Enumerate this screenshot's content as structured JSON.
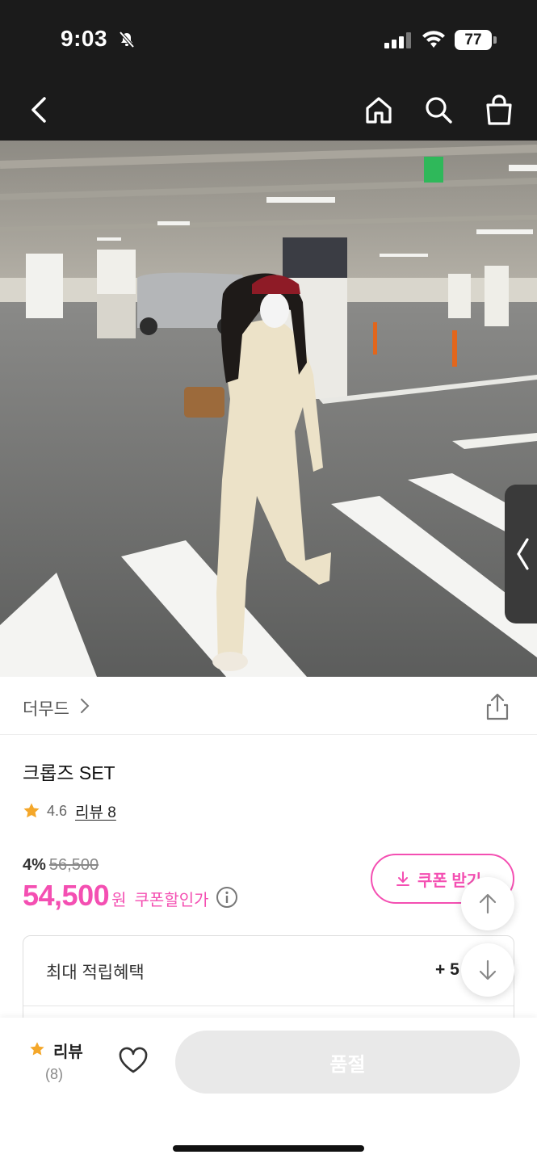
{
  "status_bar": {
    "time": "9:03",
    "battery": "77"
  },
  "nav": {
    "icons": [
      "back-icon",
      "home-icon",
      "search-icon",
      "shopping-bag-icon"
    ]
  },
  "brand": {
    "name": "더무드"
  },
  "product": {
    "title": "크롭즈 SET",
    "rating": "4.6",
    "review_label": "리뷰 8",
    "discount": "4%",
    "original_price": "56,500",
    "price": "54,500",
    "currency": "원",
    "coupon_price_label": "쿠폰할인가",
    "coupon_button": "쿠폰 받기"
  },
  "points": {
    "label": "최대 적립혜택",
    "value": "+ 5"
  },
  "bottom_bar": {
    "review_label": "리뷰",
    "review_count": "(8)",
    "buy_button": "품절"
  },
  "colors": {
    "accent": "#f44fb2",
    "star": "#f4a72a",
    "header": "#1b1b1b"
  }
}
